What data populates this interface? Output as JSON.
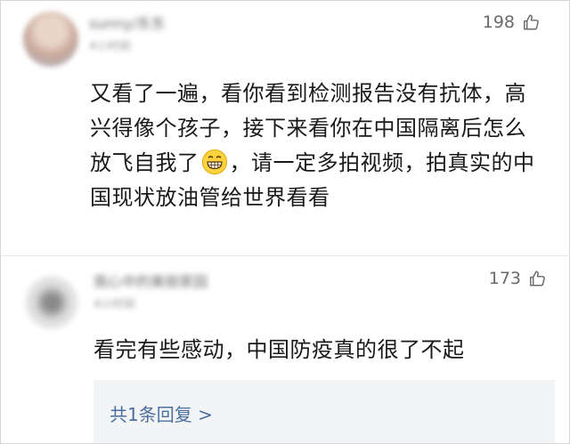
{
  "comments": [
    {
      "user": "sunny/东东",
      "time": "4小时前",
      "likes": "198",
      "text_before_emoji": "又看了一遍，看你看到检测报告没有抗体，高兴得像个孩子，接下来看你在中国隔离后怎么放飞自我了",
      "emoji": "grinning-face-emoji",
      "text_after_emoji": "，请一定多拍视频，拍真实的中国现状放油管给世界看看"
    },
    {
      "user": "我心中的美丽家园",
      "time": "4小时前",
      "likes": "173",
      "text": "看完有些感动，中国防疫真的很了不起",
      "replies_link": "共1条回复 >"
    }
  ],
  "colors": {
    "reply_link": "#4a6ea0",
    "reply_bg": "#f3f4f6",
    "text": "#1a1a1a",
    "muted": "#6a6a6a"
  },
  "icons": [
    "thumbs-up-icon",
    "grinning-face-emoji"
  ]
}
